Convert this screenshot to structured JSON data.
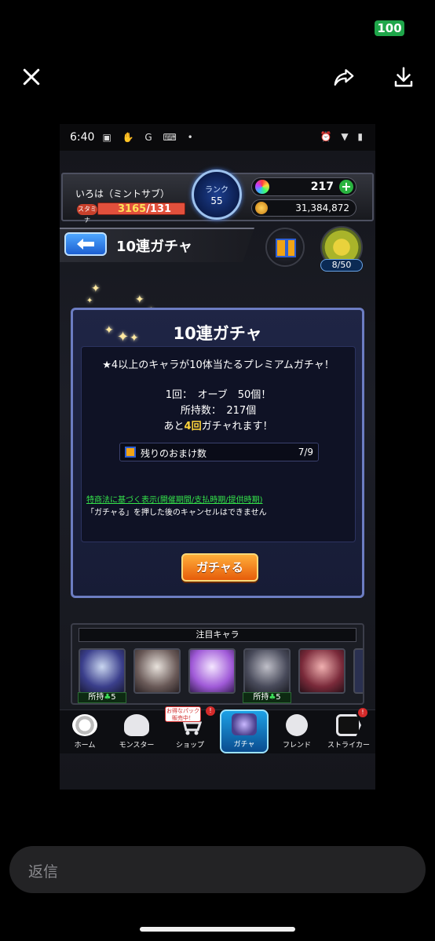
{
  "viewer": {
    "battery": "100",
    "close_icon": "close-icon",
    "share_icon": "share-icon",
    "download_icon": "download-icon",
    "reply_placeholder": "返信"
  },
  "status_bar": {
    "time": "6:40",
    "left_icons": "▣ ✋ G ⌨ •",
    "right_icons": "⏰ ▼ ▮"
  },
  "player": {
    "name": "いろは（ミントサブ）",
    "stamina_label": "スタミナ",
    "stamina_current": "3165",
    "stamina_max": "/131",
    "rank_label": "ランク",
    "rank_value": "55",
    "orbs": "217",
    "orb_add": "+",
    "coins": "31,384,872"
  },
  "header": {
    "title": "10連ガチャ",
    "medal_count": "8/50"
  },
  "dialog": {
    "title": "10連ガチャ",
    "description": "★4以上のキャラが10体当たるプレミアムガチャ！",
    "cost": "1回：　オーブ　50個！",
    "owned": "所持数：　217個",
    "remain_prefix": "あと",
    "remain_count": "4回",
    "remain_suffix": "ガチャれます！",
    "bonus_label": "残りのおまけ数",
    "bonus_count": "7/9",
    "legal_link": "特商法に基づく表示(開催期間/支払時期/提供時期)",
    "cancel_note": "「ガチャる」を押した後のキャンセルはできません",
    "gacha_button": "ガチャる"
  },
  "featured": {
    "title": "注目キャラ",
    "owned_label": "所持",
    "owned_suffix": "5",
    "characters": [
      {
        "owned": true
      },
      {
        "owned": false
      },
      {
        "owned": false
      },
      {
        "owned": true
      },
      {
        "owned": false
      }
    ]
  },
  "game_nav": {
    "shop_badge": "お得なパック販売中！",
    "alert": "!",
    "items": [
      {
        "label": "ホーム",
        "icon": "home-icon"
      },
      {
        "label": "モンスター",
        "icon": "monster-icon"
      },
      {
        "label": "ショップ",
        "icon": "cart-icon"
      },
      {
        "label": "ガチャ",
        "icon": "gacha-icon"
      },
      {
        "label": "フレンド",
        "icon": "friend-icon"
      },
      {
        "label": "ストライカー",
        "icon": "striker-icon"
      }
    ]
  },
  "colors": {
    "accent_orange": "#e65c0a",
    "highlight_yellow": "#ffd43b",
    "legal_green": "#34e34a",
    "nav_active": "#1da1e6"
  }
}
